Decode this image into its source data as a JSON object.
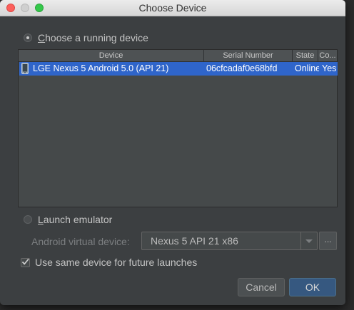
{
  "window": {
    "title": "Choose Device"
  },
  "running": {
    "label_prefix": "",
    "label_underlined": "C",
    "label_rest": "hoose a running device",
    "selected": true
  },
  "table": {
    "columns": [
      "Device",
      "Serial Number",
      "State",
      "Co..."
    ],
    "rows": [
      {
        "device": "LGE Nexus 5 Android 5.0 (API 21)",
        "serial": "06cfcadaf0e68bfd",
        "state": "Online",
        "compatible": "Yes",
        "icon": "phone-icon"
      }
    ]
  },
  "emulator": {
    "label_underlined": "L",
    "label_rest": "aunch emulator",
    "selected": false,
    "avd_label": "Android virtual device:",
    "avd_value": "Nexus 5 API 21 x86",
    "more_label": "..."
  },
  "same_device": {
    "label": "Use same device for future launches",
    "checked": true
  },
  "buttons": {
    "cancel": "Cancel",
    "ok": "OK"
  },
  "colors": {
    "selection": "#2f65ca",
    "ok_button": "#365880"
  }
}
